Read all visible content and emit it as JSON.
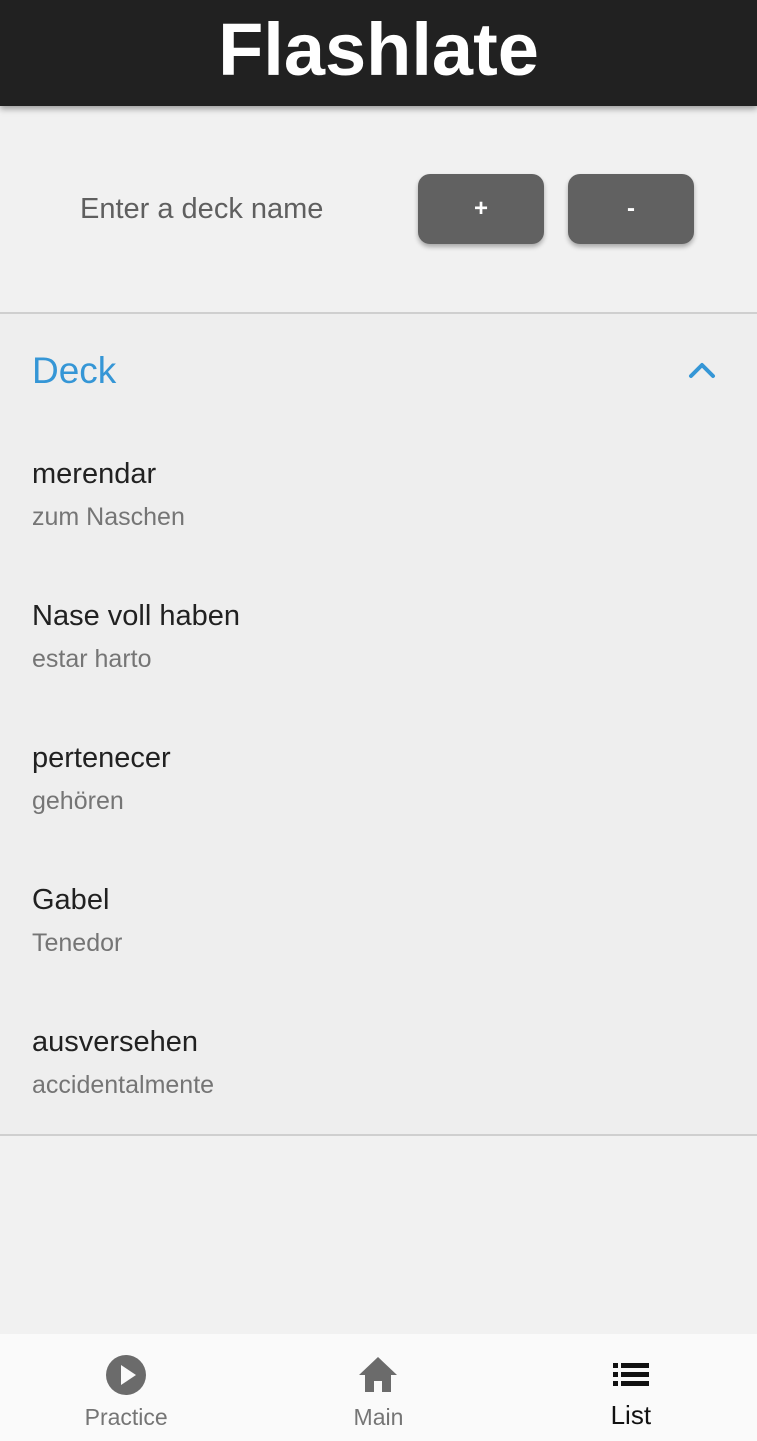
{
  "app": {
    "title": "Flashlate"
  },
  "deck_form": {
    "placeholder": "Enter a deck name",
    "add_label": "+",
    "remove_label": "-"
  },
  "deck": {
    "name": "Deck",
    "expanded": true,
    "accent_color": "#3596d6",
    "cards": [
      {
        "term": "merendar",
        "translation": "zum Naschen"
      },
      {
        "term": "Nase voll haben",
        "translation": "estar harto"
      },
      {
        "term": "pertenecer",
        "translation": "gehören"
      },
      {
        "term": "Gabel",
        "translation": "Tenedor"
      },
      {
        "term": "ausversehen",
        "translation": "accidentalmente"
      }
    ]
  },
  "bottom_nav": {
    "items": [
      {
        "label": "Practice",
        "icon": "play-circle-icon",
        "active": false
      },
      {
        "label": "Main",
        "icon": "home-icon",
        "active": false
      },
      {
        "label": "List",
        "icon": "list-icon",
        "active": true
      }
    ]
  },
  "colors": {
    "app_bar": "#212121",
    "button": "#616161",
    "background": "#f1f1f1"
  }
}
